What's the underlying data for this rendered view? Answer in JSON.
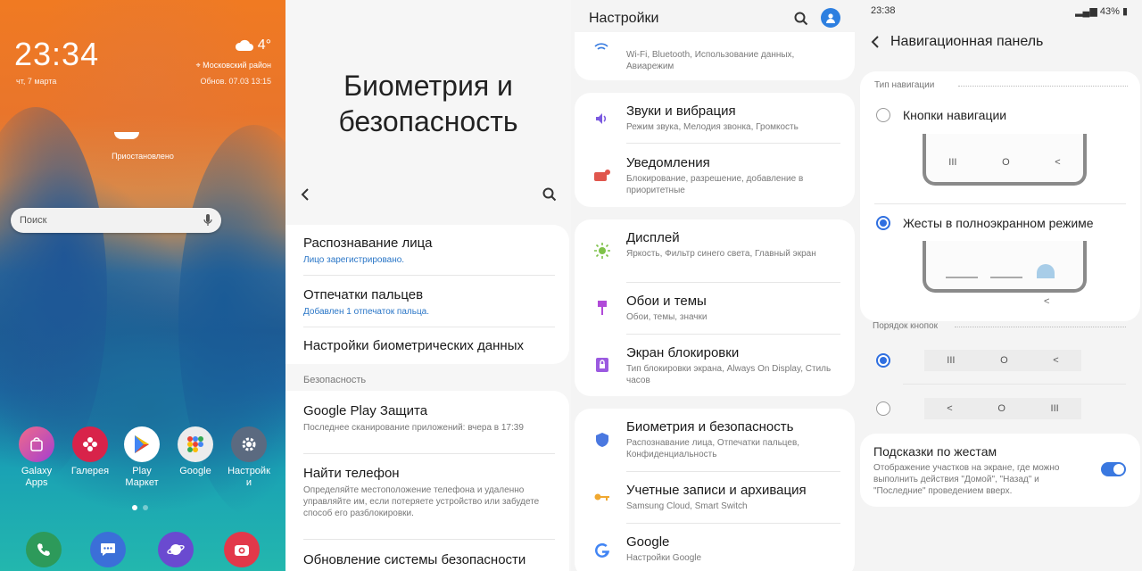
{
  "home": {
    "time": "23:34",
    "date": "чт, 7 марта",
    "temperature": "4°",
    "location": "Московский район",
    "updated": "Обнов. 07.03 13:15",
    "boat_label": "Приостановлено",
    "search_placeholder": "Поиск",
    "apps": [
      {
        "label": "Galaxy\nApps",
        "color": "#d04ab8"
      },
      {
        "label": "Галерея",
        "color": "#d8234a"
      },
      {
        "label": "Play\nМаркет",
        "color": "#ffffff"
      },
      {
        "label": "Google",
        "color": "#e9e9e9"
      },
      {
        "label": "Настройк\nи",
        "color": "#5b6a80"
      }
    ],
    "dock_colors": [
      "#2d9a5a",
      "#3b6fd8",
      "#6a4ad0",
      "#e2384a"
    ]
  },
  "biometrics": {
    "title_line1": "Биометрия и",
    "title_line2": "безопасность",
    "items": [
      {
        "title": "Распознавание лица",
        "sub": "Лицо зарегистрировано."
      },
      {
        "title": "Отпечатки пальцев",
        "sub": "Добавлен 1 отпечаток пальца."
      },
      {
        "title": "Настройки биометрических данных",
        "sub": ""
      }
    ],
    "section": "Безопасность",
    "security": [
      {
        "title": "Google Play Защита",
        "sub": "Последнее сканирование приложений: вчера в 17:39"
      },
      {
        "title": "Найти телефон",
        "sub": "Определяйте местоположение телефона и удаленно управляйте им, если потеряете устройство или забудете способ его разблокировки."
      },
      {
        "title": "Обновление системы безопасности",
        "sub": ""
      }
    ]
  },
  "settings": {
    "title": "Настройки",
    "top_sub": "Wi-Fi, Bluetooth, Использование данных, Авиарежим",
    "items": [
      {
        "title": "Звуки и вибрация",
        "sub": "Режим звука, Мелодия звонка, Громкость"
      },
      {
        "title": "Уведомления",
        "sub": "Блокирование, разрешение, добавление в приоритетные"
      },
      {
        "title": "Дисплей",
        "sub": "Яркость, Фильтр синего света, Главный экран"
      },
      {
        "title": "Обои и темы",
        "sub": "Обои, темы, значки"
      },
      {
        "title": "Экран блокировки",
        "sub": "Тип блокировки экрана, Always On Display, Стиль часов"
      },
      {
        "title": "Биометрия и безопасность",
        "sub": "Распознавание лица, Отпечатки пальцев, Конфиденциальность"
      },
      {
        "title": "Учетные записи и архивация",
        "sub": "Samsung Cloud, Smart Switch"
      },
      {
        "title": "Google",
        "sub": "Настройки Google"
      }
    ]
  },
  "navbar": {
    "status_time": "23:38",
    "battery": "43%",
    "title": "Навигационная панель",
    "type_section": "Тип навигации",
    "option_buttons": "Кнопки навигации",
    "option_gestures": "Жесты в полноэкранном режиме",
    "order_section": "Порядок кнопок",
    "hints_title": "Подсказки по жестам",
    "hints_sub": "Отображение участков на экране, где можно выполнить действия \"Домой\", \"Назад\" и \"Последние\" проведением вверх.",
    "sym_recent": "III",
    "sym_home": "O",
    "sym_back": "<",
    "accent": "#2f6fe0"
  }
}
